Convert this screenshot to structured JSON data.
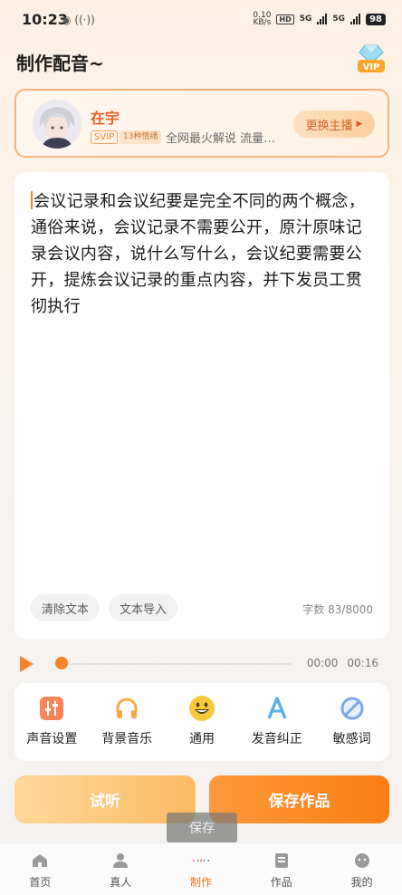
{
  "status_bar": {
    "time": "10:23",
    "network_speed": "0.10",
    "network_speed_unit": "KB/s",
    "hd_label": "HD",
    "net1": "5G",
    "net2": "5G",
    "battery": "98"
  },
  "header": {
    "title": "制作配音~",
    "vip_badge": "VIP"
  },
  "host": {
    "name": "在宇",
    "svip_tag": "SVIP",
    "emotion_tag": "13种情绪",
    "description": "全网最火解说 流量…",
    "switch_button": "更换主播"
  },
  "editor": {
    "text": "会议记录和会议纪要是完全不同的两个概念，通俗来说，会议记录不需要公开，原汁原味记录会议内容，说什么写什么，会议纪要需要公开，提炼会议记录的重点内容，并下发员工贯彻执行",
    "clear_button": "清除文本",
    "import_button": "文本导入",
    "counter_label": "字数",
    "counter_value": "83/8000"
  },
  "player": {
    "current_time": "00:00",
    "total_time": "00:16",
    "progress": 0
  },
  "tools": [
    {
      "label": "声音设置",
      "icon": "sliders-icon"
    },
    {
      "label": "背景音乐",
      "icon": "headphones-icon"
    },
    {
      "label": "通用",
      "icon": "smiley-icon"
    },
    {
      "label": "发音纠正",
      "icon": "letter-a-icon"
    },
    {
      "label": "敏感词",
      "icon": "prohibited-icon"
    }
  ],
  "actions": {
    "listen": "试听",
    "save": "保存作品"
  },
  "toast": "保存",
  "nav": [
    {
      "label": "首页",
      "icon": "home-icon"
    },
    {
      "label": "真人",
      "icon": "person-icon"
    },
    {
      "label": "制作",
      "icon": "make-icon"
    },
    {
      "label": "作品",
      "icon": "document-icon"
    },
    {
      "label": "我的",
      "icon": "profile-icon"
    }
  ],
  "colors": {
    "accent": "#f7842a",
    "accent_dark": "#f0701c",
    "card_border": "#f7b077"
  }
}
